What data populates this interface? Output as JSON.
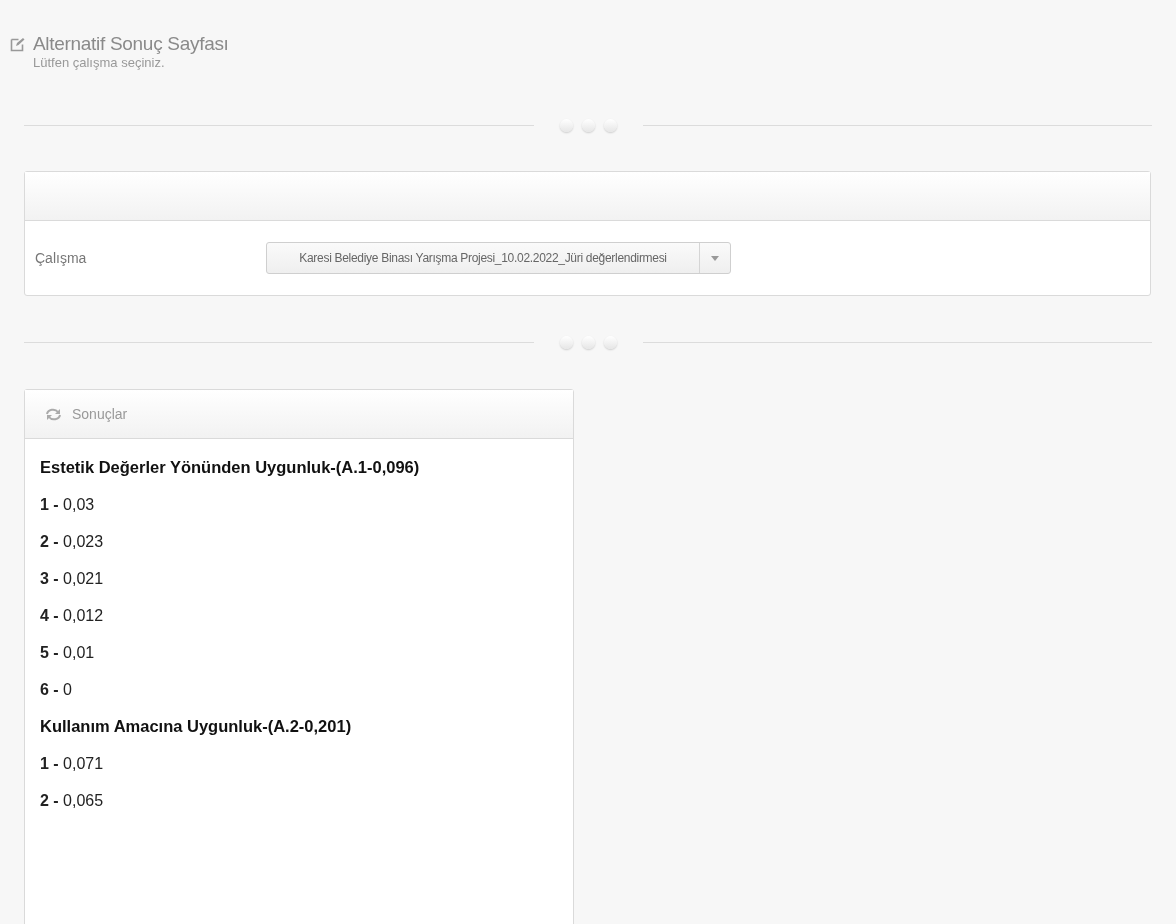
{
  "page_header": {
    "title": "Alternatif Sonuç Sayfası",
    "subtitle": "Lütfen çalışma seçiniz."
  },
  "selection_card": {
    "label": "Çalışma",
    "select_value": "Karesi Belediye Binası Yarışma Projesi_10.02.2022_Jüri değerlendirmesi"
  },
  "results_panel": {
    "title": "Sonuçlar",
    "groups": [
      {
        "heading": "Estetik Değerler Yönünden Uygunluk-(A.1-0,096)",
        "items": [
          "**1 -** 0,03",
          "**2 -** 0,023",
          "**3 -** 0,021",
          "**4 -** 0,012",
          "**5 -** 0,01",
          "**6 -** 0"
        ]
      },
      {
        "heading": "Kullanım Amacına Uygunluk-(A.2-0,201)",
        "items": [
          "**1 -** 0,071",
          "**2 -** 0,065"
        ]
      }
    ]
  }
}
